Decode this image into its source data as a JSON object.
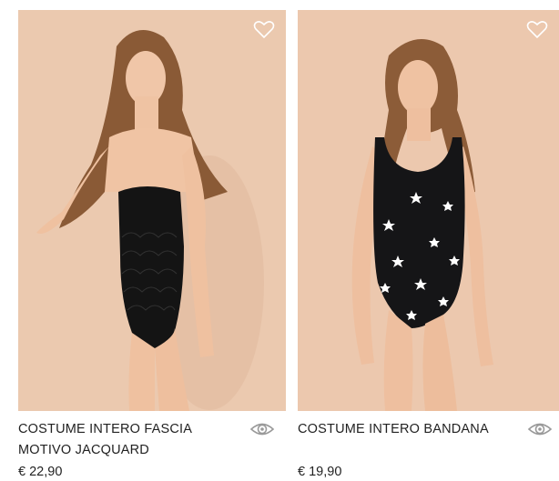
{
  "products": [
    {
      "title": "COSTUME INTERO FASCIA MOTIVO JACQUARD",
      "price": "€ 22,90",
      "image_alt": "Modella con costume intero nero a fascia in pizzo jacquard",
      "wishlist_icon": "heart-outline-icon",
      "quickview_icon": "eye-icon"
    },
    {
      "title": "COSTUME INTERO BANDANA",
      "price": "€ 19,90",
      "image_alt": "Modella con costume intero nero con stelle bianche",
      "wishlist_icon": "heart-outline-icon",
      "quickview_icon": "eye-icon"
    }
  ],
  "colors": {
    "photo_background": "#e9c7ad",
    "swimsuit": "#141414",
    "text": "#222222",
    "icon": "#9a9a9a"
  }
}
